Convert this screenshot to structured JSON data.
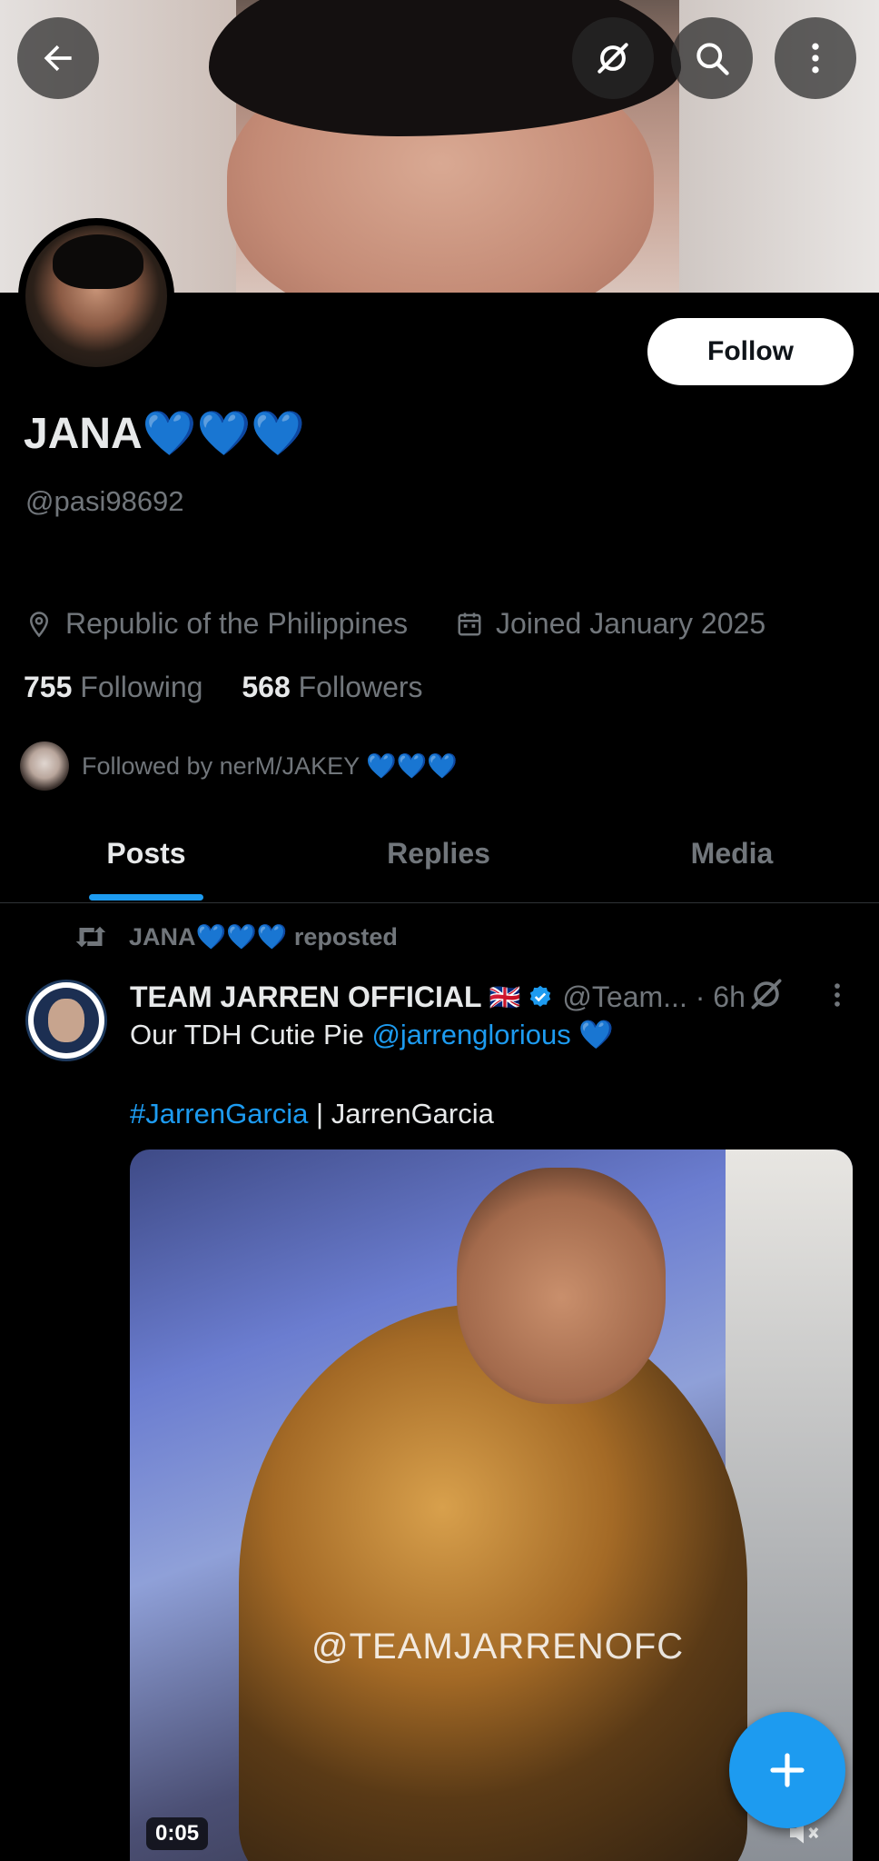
{
  "profile": {
    "display_name": "JANA💙💙💙",
    "handle": "@pasi98692",
    "location": "Republic of the Philippines",
    "joined": "Joined January 2025",
    "following_count": "755",
    "following_label": "Following",
    "followers_count": "568",
    "followers_label": "Followers",
    "followed_by": "Followed by nerM/JAKEY 💙💙💙",
    "follow_label": "Follow"
  },
  "tabs": [
    {
      "label": "Posts",
      "active": true
    },
    {
      "label": "Replies",
      "active": false
    },
    {
      "label": "Media",
      "active": false
    }
  ],
  "post": {
    "repost_label": "JANA💙💙💙 reposted",
    "author_name": "TEAM JARREN OFFICIAL",
    "author_flag": "🇬🇧",
    "author_handle_time": "@Team... · 6h",
    "text_prefix": "Our TDH Cutie Pie ",
    "mention": "@jarrenglorious",
    "text_suffix": " 💙",
    "hashtag": "#JarrenGarcia",
    "hashtag_suffix": " | JarrenGarcia",
    "media_watermark": "@TEAMJARRENOFC",
    "video_time": "0:05"
  },
  "icons": {
    "back": "arrow-left-icon",
    "grok": "grok-icon",
    "search": "search-icon",
    "more": "more-vertical-icon",
    "location": "location-pin-icon",
    "calendar": "calendar-icon",
    "repost": "repost-icon",
    "verified": "verified-badge-icon",
    "compose": "plus-icon",
    "mute": "mute-icon"
  },
  "colors": {
    "accent": "#1d9bf0",
    "background": "#000000",
    "text": "#e7e9ea",
    "muted": "#71767b"
  }
}
